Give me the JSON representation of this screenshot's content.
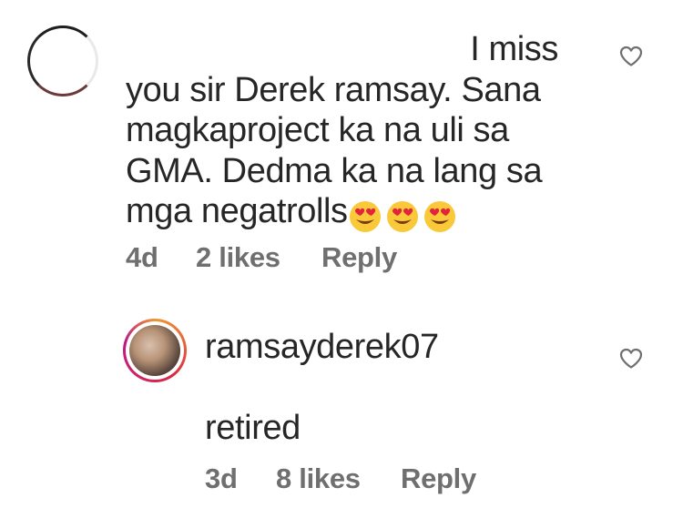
{
  "comments": [
    {
      "text_lines": [
        "I miss",
        "you sir Derek ramsay. Sana",
        "magkaproject ka na uli sa",
        "GMA. Dedma ka na lang sa",
        "mga negatrolls"
      ],
      "emojis": [
        "heart-eyes-emoji",
        "heart-eyes-emoji",
        "heart-eyes-emoji"
      ],
      "time": "4d",
      "likes": "2 likes",
      "reply_label": "Reply"
    },
    {
      "username": "ramsayderek07",
      "text": "retired",
      "time": "3d",
      "likes": "8 likes",
      "reply_label": "Reply"
    }
  ],
  "icons": {
    "like": "heart-outline-icon"
  },
  "colors": {
    "text": "#262626",
    "meta": "#6f6f6f",
    "emoji": "#f9c93a",
    "emoji_heart": "#e2233d"
  }
}
